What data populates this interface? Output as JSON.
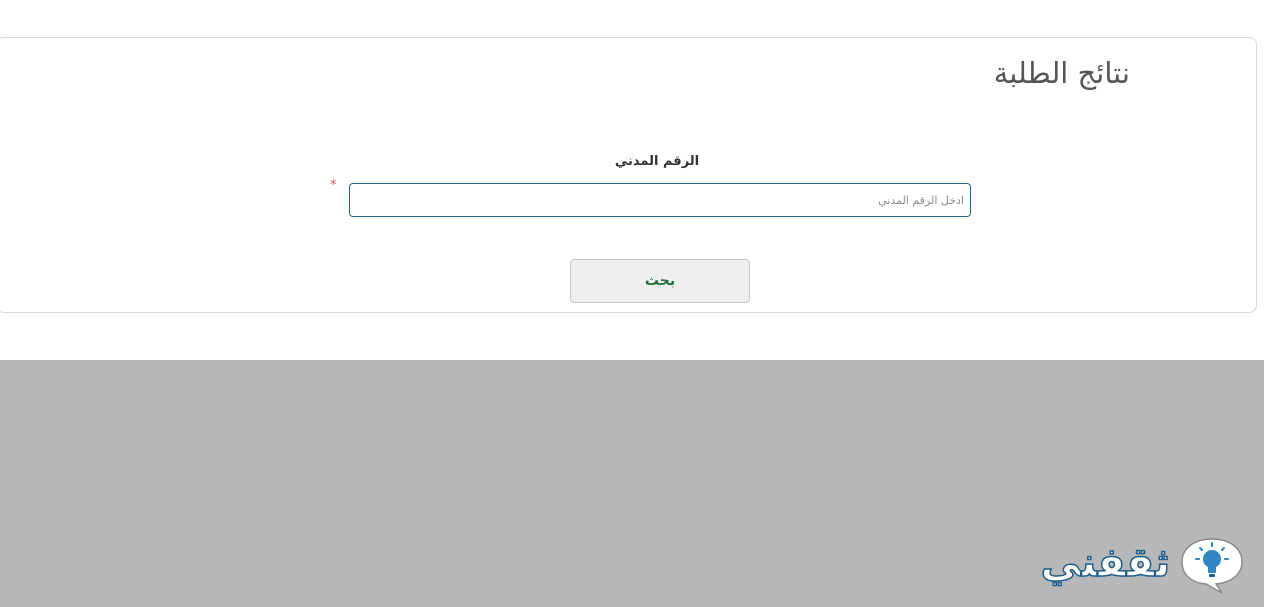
{
  "form": {
    "title": "نتائج الطلبة",
    "civil_id_label": "الرقم المدني",
    "required_marker": "*",
    "civil_id_placeholder": "ادخل الرقم المدني",
    "civil_id_value": "",
    "search_label": "بحث"
  },
  "footer": {
    "brand_name": "ثقفني",
    "brand_icon": "lightbulb-speech-bubble-icon"
  },
  "colors": {
    "input_border": "#1b6d86",
    "button_text": "#1e6f3a",
    "required": "#d9534f",
    "footer_bg": "#b6b7b9",
    "brand_blue": "#1f5e86"
  }
}
